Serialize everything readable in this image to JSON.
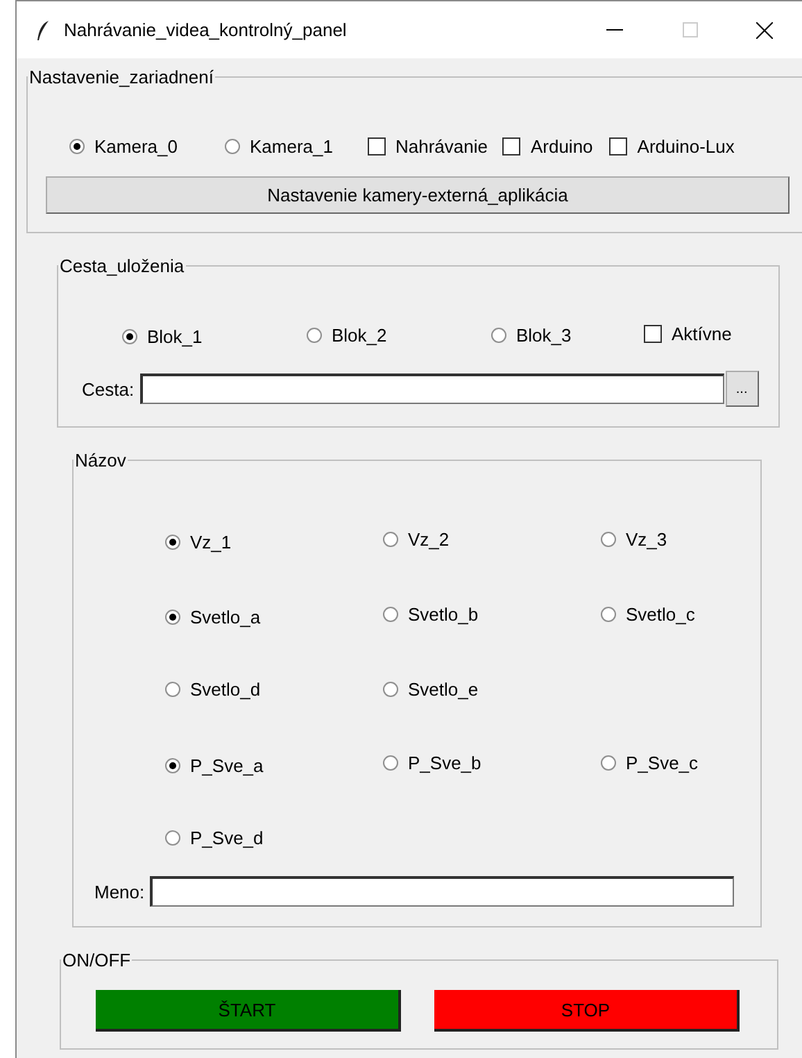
{
  "window": {
    "title": "Nahrávanie_videa_kontrolný_panel"
  },
  "devices": {
    "title": "Nastavenie_zariadnení",
    "options": [
      {
        "kind": "radio",
        "label": "Kamera_0",
        "selected": true
      },
      {
        "kind": "radio",
        "label": "Kamera_1",
        "selected": false
      },
      {
        "kind": "checkbox",
        "label": "Nahrávanie",
        "checked": false
      },
      {
        "kind": "checkbox",
        "label": "Arduino",
        "checked": false
      },
      {
        "kind": "checkbox",
        "label": "Arduino-Lux",
        "checked": false
      }
    ],
    "button": "Nastavenie kamery-externá_aplikácia"
  },
  "storage": {
    "title": "Cesta_uloženia",
    "options": [
      {
        "kind": "radio",
        "label": "Blok_1",
        "selected": true
      },
      {
        "kind": "radio",
        "label": "Blok_2",
        "selected": false
      },
      {
        "kind": "radio",
        "label": "Blok_3",
        "selected": false
      },
      {
        "kind": "checkbox",
        "label": "Aktívne",
        "checked": false
      }
    ],
    "path_label": "Cesta:",
    "browse_button": "..."
  },
  "name": {
    "title": "Názov",
    "rows": [
      [
        {
          "label": "Vz_1",
          "selected": true
        },
        {
          "label": "Vz_2",
          "selected": false
        },
        {
          "label": "Vz_3",
          "selected": false
        }
      ],
      [
        {
          "label": "Svetlo_a",
          "selected": true
        },
        {
          "label": "Svetlo_b",
          "selected": false
        },
        {
          "label": "Svetlo_c",
          "selected": false
        }
      ],
      [
        {
          "label": "Svetlo_d",
          "selected": false
        },
        {
          "label": "Svetlo_e",
          "selected": false
        }
      ],
      [
        {
          "label": "P_Sve_a",
          "selected": true
        },
        {
          "label": "P_Sve_b",
          "selected": false
        },
        {
          "label": "P_Sve_c",
          "selected": false
        }
      ],
      [
        {
          "label": "P_Sve_d",
          "selected": false
        }
      ]
    ],
    "name_label": "Meno:"
  },
  "onoff": {
    "title": "ON/OFF",
    "buttons": [
      {
        "label": "ŠTART",
        "color": "#008000"
      },
      {
        "label": "STOP",
        "color": "#ff0000"
      }
    ]
  }
}
